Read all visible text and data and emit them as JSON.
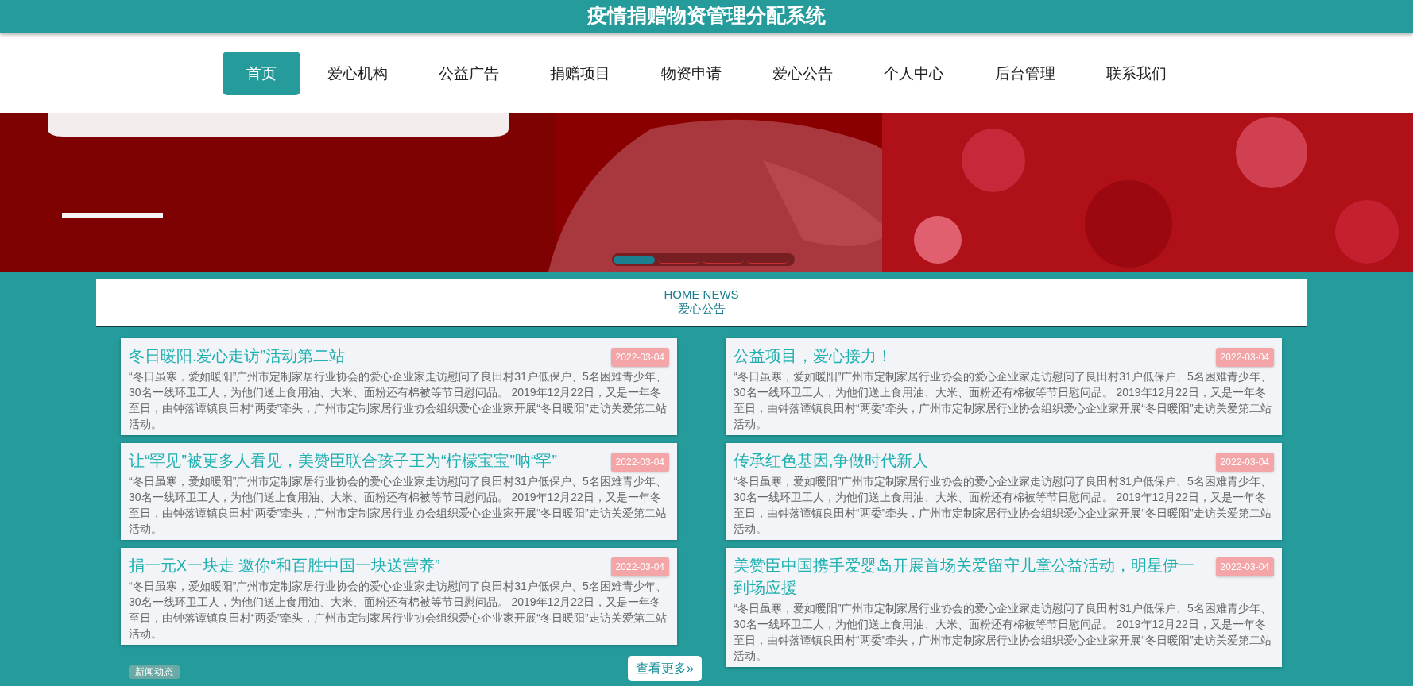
{
  "header": {
    "title": "疫情捐赠物资管理分配系统"
  },
  "nav": [
    {
      "label": "首页",
      "selected": true
    },
    {
      "label": "爱心机构",
      "selected": false
    },
    {
      "label": "公益广告",
      "selected": false
    },
    {
      "label": "捐赠项目",
      "selected": false
    },
    {
      "label": "物资申请",
      "selected": false
    },
    {
      "label": "爱心公告",
      "selected": false
    },
    {
      "label": "个人中心",
      "selected": false
    },
    {
      "label": "后台管理",
      "selected": false
    },
    {
      "label": "联系我们",
      "selected": false
    }
  ],
  "banner": {
    "kind": "picture",
    "slides": [
      {
        "selected": true
      },
      {
        "selected": false
      },
      {
        "selected": false
      },
      {
        "selected": false
      }
    ]
  },
  "section": {
    "subtitle": "HOME NEWS",
    "title": "爱心公告"
  },
  "news": [
    {
      "title": "冬日暖阳.爱心走访”活动第二站",
      "date": "2022-03-04",
      "summary": "“冬日虽寒，爱如暖阳”广州市定制家居行业协会的爱心企业家走访慰问了良田村31户低保户、5名困难青少年、30名一线环卫工人，为他们送上食用油、大米、面粉还有棉被等节日慰问品。 2019年12月22日，又是一年冬至日，由钟落谭镇良田村“两委”牵头，广州市定制家居行业协会组织爱心企业家开展“冬日暖阳”走访关爱第二站活动。"
    },
    {
      "title": "公益项目，爱心接力！",
      "date": "2022-03-04",
      "summary": "“冬日虽寒，爱如暖阳”广州市定制家居行业协会的爱心企业家走访慰问了良田村31户低保户、5名困难青少年、30名一线环卫工人，为他们送上食用油、大米、面粉还有棉被等节日慰问品。 2019年12月22日，又是一年冬至日，由钟落谭镇良田村“两委”牵头，广州市定制家居行业协会组织爱心企业家开展“冬日暖阳”走访关爱第二站活动。"
    },
    {
      "title": "让“罕见”被更多人看见，美赞臣联合孩子王为“柠檬宝宝”呐“罕”",
      "date": "2022-03-04",
      "summary": "“冬日虽寒，爱如暖阳”广州市定制家居行业协会的爱心企业家走访慰问了良田村31户低保户、5名困难青少年、30名一线环卫工人，为他们送上食用油、大米、面粉还有棉被等节日慰问品。 2019年12月22日，又是一年冬至日，由钟落谭镇良田村“两委”牵头，广州市定制家居行业协会组织爱心企业家开展“冬日暖阳”走访关爱第二站活动。"
    },
    {
      "title": "传承红色基因,争做时代新人",
      "date": "2022-03-04",
      "summary": "“冬日虽寒，爱如暖阳”广州市定制家居行业协会的爱心企业家走访慰问了良田村31户低保户、5名困难青少年、30名一线环卫工人，为他们送上食用油、大米、面粉还有棉被等节日慰问品。 2019年12月22日，又是一年冬至日，由钟落谭镇良田村“两委”牵头，广州市定制家居行业协会组织爱心企业家开展“冬日暖阳”走访关爱第二站活动。"
    },
    {
      "title": "捐一元X一块走 邀你“和百胜中国一块送营养”",
      "date": "2022-03-04",
      "summary": "“冬日虽寒，爱如暖阳”广州市定制家居行业协会的爱心企业家走访慰问了良田村31户低保户、5名困难青少年、30名一线环卫工人，为他们送上食用油、大米、面粉还有棉被等节日慰问品。 2019年12月22日，又是一年冬至日，由钟落谭镇良田村“两委”牵头，广州市定制家居行业协会组织爱心企业家开展“冬日暖阳”走访关爱第二站活动。"
    },
    {
      "title": "美赞臣中国携手爱婴岛开展首场关爱留守儿童公益活动，明星伊一到场应援",
      "date": "2022-03-04",
      "summary": "“冬日虽寒，爱如暖阳”广州市定制家居行业协会的爱心企业家走访慰问了良田村31户低保户、5名困难青少年、30名一线环卫工人，为他们送上食用油、大米、面粉还有棉被等节日慰问品。 2019年12月22日，又是一年冬至日，由钟落谭镇良田村“两委”牵头，广州市定制家居行业协会组织爱心企业家开展“冬日暖阳”走访关爱第二站活动。"
    }
  ],
  "footer": {
    "tag": "新闻动态",
    "more_button": "查看更多»"
  }
}
